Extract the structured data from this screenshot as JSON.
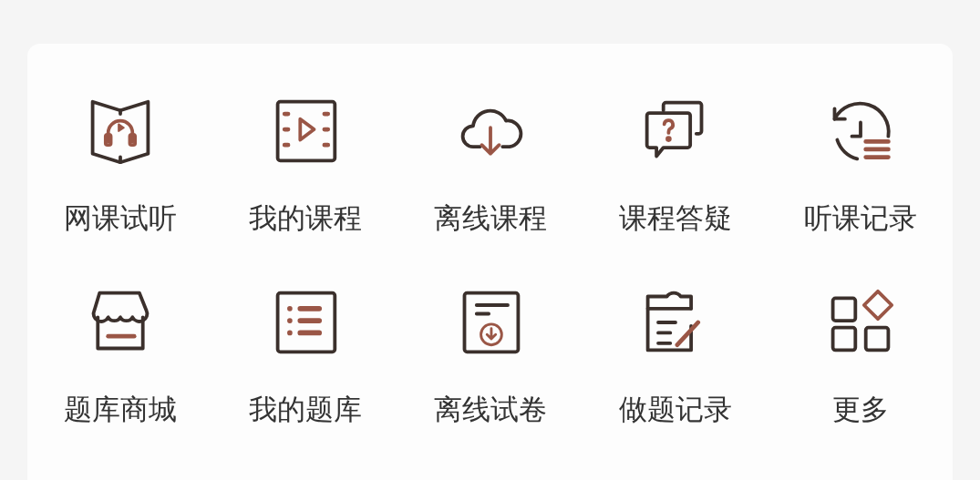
{
  "grid": [
    {
      "kind": "book-headphones",
      "label": "网课试听"
    },
    {
      "kind": "film-play",
      "label": "我的课程"
    },
    {
      "kind": "cloud-download",
      "label": "离线课程"
    },
    {
      "kind": "chat-question",
      "label": "课程答疑"
    },
    {
      "kind": "history-list",
      "label": "听课记录"
    },
    {
      "kind": "store",
      "label": "题库商城"
    },
    {
      "kind": "list-doc",
      "label": "我的题库"
    },
    {
      "kind": "doc-download",
      "label": "离线试卷"
    },
    {
      "kind": "clipboard-pen",
      "label": "做题记录"
    },
    {
      "kind": "apps",
      "label": "更多"
    }
  ]
}
